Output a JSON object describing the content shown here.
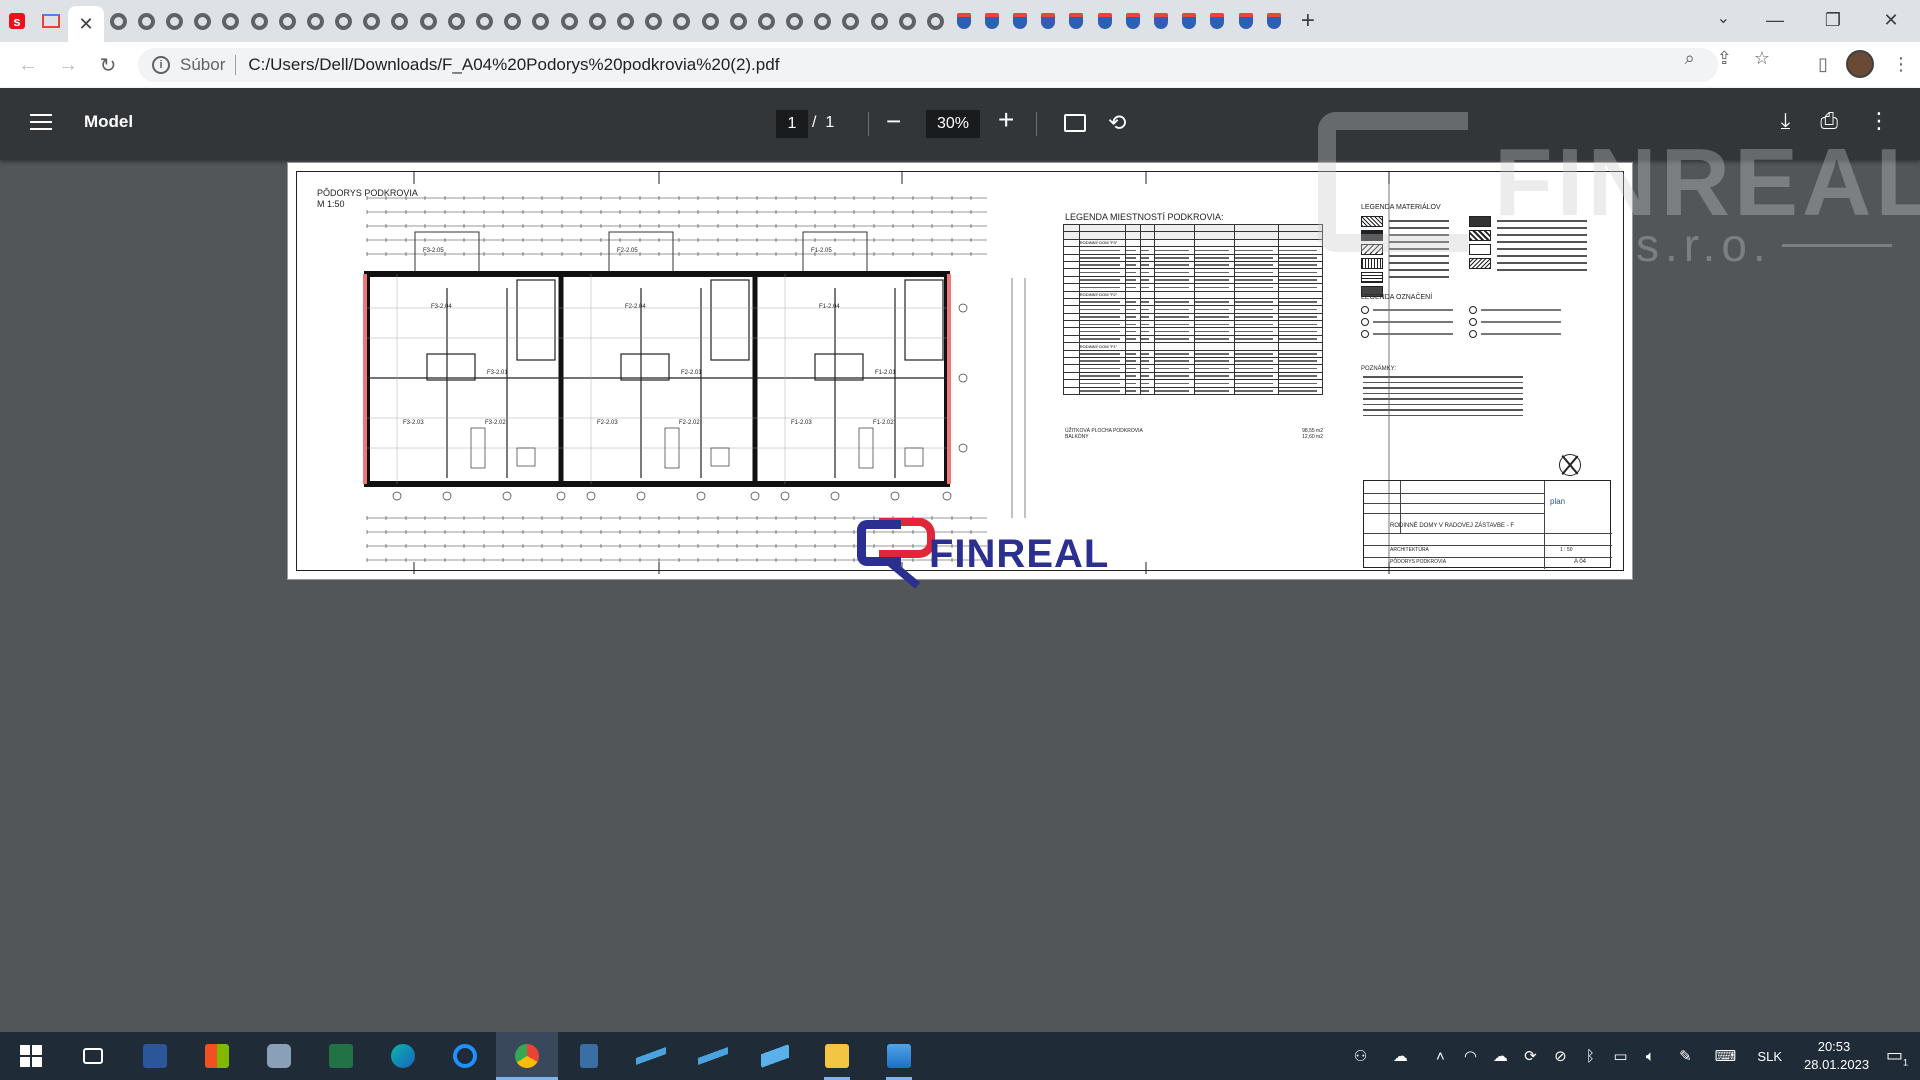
{
  "browser": {
    "address": {
      "scheme_label": "Súbor",
      "url": "C:/Users/Dell/Downloads/F_A04%20Podorys%20podkrovia%20(2).pdf"
    },
    "window_controls": {
      "minimize": "—",
      "restore": "❐",
      "close": "✕"
    }
  },
  "pdf_viewer": {
    "title": "Model",
    "current_page": "1",
    "page_separator": "/",
    "total_pages": "1",
    "zoom": "30%"
  },
  "watermark": {
    "brand": "FINREAL",
    "suffix": "s.r.o."
  },
  "drawing": {
    "plan_title": "PÔDORYS PODKROVIA",
    "plan_scale": "M 1:50",
    "rooms_top": [
      "F3-2.05",
      "F2-2.05",
      "F1-2.05"
    ],
    "rooms_mid": [
      "F3-2.04",
      "F2-2.04",
      "F1-2.04"
    ],
    "rooms_center": [
      "F3-2.01",
      "F2-2.01",
      "F1-2.01"
    ],
    "rooms_bottom_left": [
      "F3-2.03",
      "F2-2.03",
      "F1-2.03"
    ],
    "rooms_bottom_right": [
      "F3-2.02",
      "F2-2.02",
      "F1-2.02"
    ],
    "legend_rooms_title": "LEGENDA MIESTNOSTÍ PODKROVIA:",
    "legend_materials_title": "LEGENDA MATERIÁLOV",
    "legend_marks_title": "LEGENDA OZNAČENÍ",
    "notes_title": "POZNÁMKY:",
    "legend_sections": [
      "RODINNÝ DOM \"F3\"",
      "RODINNÝ DOM \"F2\"",
      "RODINNÝ DOM \"F1\""
    ],
    "legend_total": "ÚŽITKOVÁ PLOCHA PODKROVIA",
    "legend_balcony": "BALKÓNY",
    "legend_total_value": "98,55 m2",
    "legend_balcony_value": "12,60 m2",
    "titleblock_project": "RODINNÉ DOMY V RADOVEJ ZÁSTAVBE - F",
    "titleblock_part": "ARCHITEKTÚRA",
    "titleblock_drawing": "PÔDORYS PODKROVIA",
    "titleblock_number": "A 04",
    "titleblock_scale": "1 : 50",
    "titleblock_logo": "plan",
    "brand_logo": "FINREAL"
  },
  "taskbar": {
    "language": "SLK",
    "time": "20:53",
    "date": "28.01.2023",
    "notifications": "1"
  },
  "colors": {
    "pdf_background": "#525659",
    "pdf_toolbar": "#323639",
    "taskbar": "#1f2b37",
    "brand_blue": "#2b2f8f",
    "brand_red": "#e0263a"
  }
}
